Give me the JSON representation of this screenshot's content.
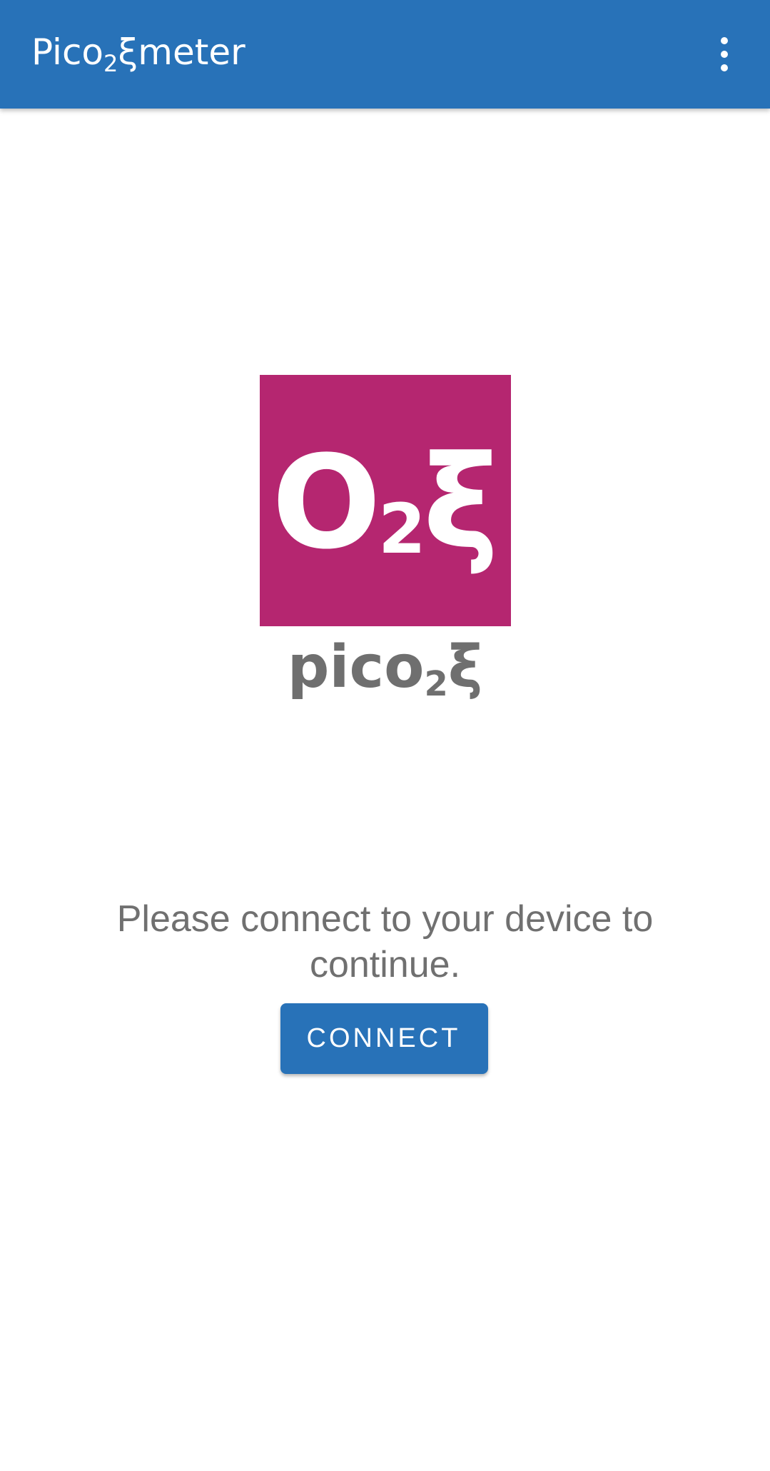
{
  "app_bar": {
    "title_main": "Pico",
    "title_sub": "2",
    "title_rest": "ξmeter",
    "overflow_icon": "more-vert-icon",
    "background_color": "#2872b8"
  },
  "logo": {
    "main": "O",
    "sub": "2",
    "rest": "ξ",
    "background_color": "#b52670"
  },
  "brand": {
    "main": "pico",
    "sub": "2",
    "rest": "ξ"
  },
  "message": "Please connect to your device to continue.",
  "connect_button": {
    "label": "CONNECT"
  }
}
